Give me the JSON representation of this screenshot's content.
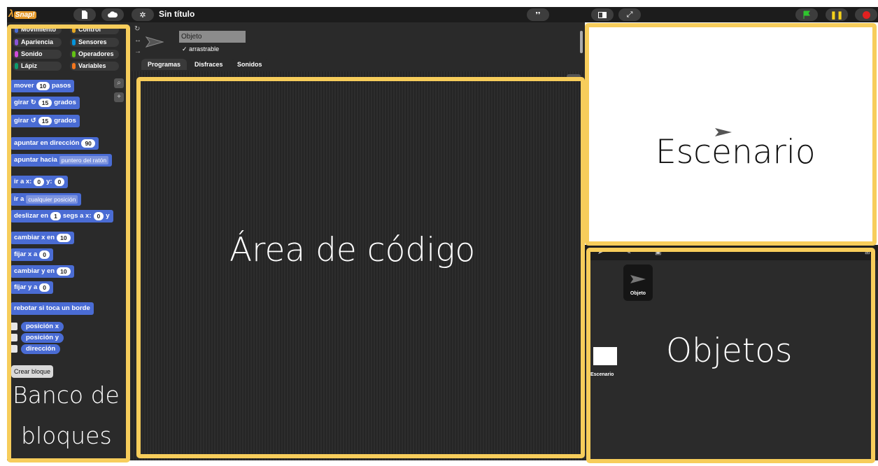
{
  "topbar": {
    "logo_lambda": "λ",
    "logo_text": "Snap!",
    "project_title": "Sin título"
  },
  "palette": {
    "categories": [
      {
        "label": "Movimiento",
        "color": "#4a6cd4"
      },
      {
        "label": "Control",
        "color": "#e6a822"
      },
      {
        "label": "Apariencia",
        "color": "#8a55d7"
      },
      {
        "label": "Sensores",
        "color": "#0494dc"
      },
      {
        "label": "Sonido",
        "color": "#cf4ad9"
      },
      {
        "label": "Operadores",
        "color": "#62c213"
      },
      {
        "label": "Lápiz",
        "color": "#0e9a6c"
      },
      {
        "label": "Variables",
        "color": "#f3761d"
      }
    ],
    "blocks": {
      "move": {
        "text": "mover",
        "value": "10",
        "suffix": "pasos"
      },
      "turn_cw": {
        "text": "girar ↻",
        "value": "15",
        "suffix": "grados"
      },
      "turn_ccw": {
        "text": "girar ↺",
        "value": "15",
        "suffix": "grados"
      },
      "point_dir": {
        "text": "apuntar en dirección",
        "value": "90"
      },
      "point_towards": {
        "text": "apuntar hacia",
        "option": "puntero del ratón"
      },
      "goto_xy": {
        "text": "ir a x:",
        "x": "0",
        "ylabel": "y:",
        "y": "0"
      },
      "goto": {
        "text": "ir a",
        "option": "cualquier posición"
      },
      "glide": {
        "text": "deslizar en",
        "secs": "1",
        "mid": "segs a x:",
        "x": "0",
        "ylabel": "y"
      },
      "change_x": {
        "text": "cambiar x en",
        "value": "10"
      },
      "set_x": {
        "text": "fijar x a",
        "value": "0"
      },
      "change_y": {
        "text": "cambiar y en",
        "value": "10"
      },
      "set_y": {
        "text": "fijar y a",
        "value": "0"
      },
      "bounce": {
        "text": "rebotar si toca un borde"
      }
    },
    "reporters": [
      "posición x",
      "posición y",
      "dirección"
    ],
    "make_block": "Crear bloque"
  },
  "sprite": {
    "name": "Objeto",
    "draggable": "arrastrable",
    "tabs": [
      "Programas",
      "Disfraces",
      "Sonidos"
    ]
  },
  "corral": {
    "sprite_label": "Objeto",
    "stage_label": "Escenario"
  },
  "annotations": {
    "palette_line1": "Banco de",
    "palette_line2": "bloques",
    "scripts": "Área de código",
    "stage": "Escenario",
    "corral": "Objetos",
    "frame_color": "#f7cd5b"
  }
}
